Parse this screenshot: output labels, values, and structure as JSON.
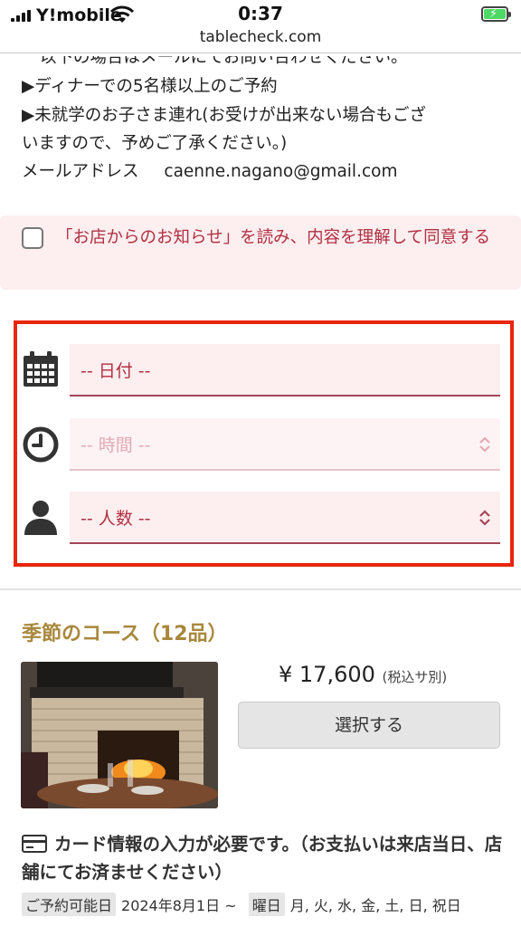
{
  "status_bar": {
    "carrier": "Y!mobile",
    "time": "0:37",
    "url": "tablecheck.com"
  },
  "notice": {
    "partial_line": "以下の場合はメールにてお問い合わせください。",
    "items": [
      "▶ディナーでの5名様以上のご予約",
      "▶未就学のお子さま連れ(お受けが出来ない場合もござ",
      "いますので、予めご了承ください。)"
    ],
    "mail_label": "メールアドレス",
    "mail_address": "caenne.nagano@gmail.com"
  },
  "agree": {
    "checked": false,
    "text": "「お店からのお知らせ」を読み、内容を理解して同意する"
  },
  "form": {
    "date_placeholder": "-- 日付 --",
    "time_placeholder": "-- 時間 --",
    "people_placeholder": "-- 人数 --"
  },
  "course": {
    "title": "季節のコース（12品）",
    "price": "¥ 17,600",
    "price_note": "(税込サ別)",
    "select_label": "選択する",
    "card_note": "カード情報の入力が必要です。（お支払いは来店当日、店舗にてお済ませください）",
    "available_label": "ご予約可能日",
    "available_value": "2024年8月1日 ~",
    "days_label": "曜日",
    "days_value": "月, 火, 水, 金, 土, 日, 祝日"
  },
  "colors": {
    "accent_red": "#e8260d",
    "pink_text": "#b03042",
    "field_bg": "#fdeef0",
    "course_gold": "#a8883c"
  },
  "icons": {
    "date": "calendar-icon",
    "time": "clock-icon",
    "people": "person-icon",
    "card": "credit-card-icon"
  }
}
